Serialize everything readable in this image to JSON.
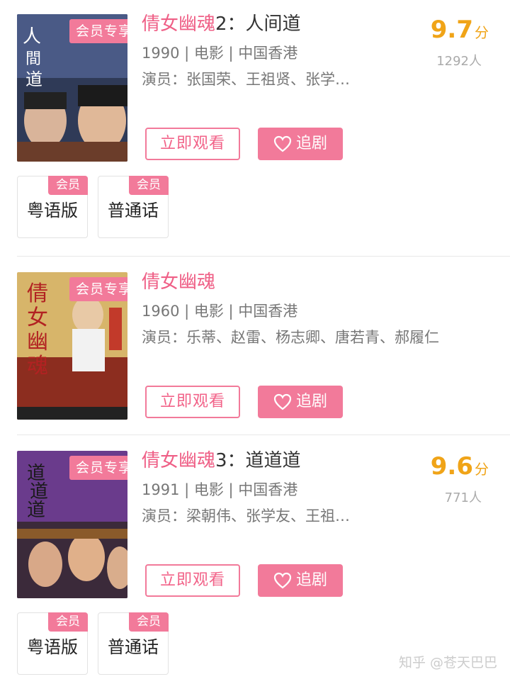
{
  "items": [
    {
      "title_pink": "倩女幽魂",
      "title_rest": "2：人间道",
      "meta": "1990 | 电影 | 中国香港",
      "actors": "演员：张国荣、王祖贤、张学…",
      "vip_tag": "会员专享",
      "score": "9.7",
      "score_unit": "分",
      "count": "1292人",
      "watch_label": "立即观看",
      "follow_label": "追剧",
      "langs": [
        {
          "label": "粤语版",
          "badge": "会员"
        },
        {
          "label": "普通话",
          "badge": "会员"
        }
      ]
    },
    {
      "title_pink": "倩女幽魂",
      "title_rest": "",
      "meta": "1960 | 电影 | 中国香港",
      "actors": "演员：乐蒂、赵雷、杨志卿、唐若青、郝履仁",
      "vip_tag": "会员专享",
      "watch_label": "立即观看",
      "follow_label": "追剧"
    },
    {
      "title_pink": "倩女幽魂",
      "title_rest": "3：道道道",
      "meta": "1991 | 电影 | 中国香港",
      "actors": "演员：梁朝伟、张学友、王祖…",
      "vip_tag": "会员专享",
      "score": "9.6",
      "score_unit": "分",
      "count": "771人",
      "watch_label": "立即观看",
      "follow_label": "追剧",
      "langs": [
        {
          "label": "粤语版",
          "badge": "会员"
        },
        {
          "label": "普通话",
          "badge": "会员"
        }
      ]
    }
  ],
  "watermark": "知乎 @苍天巴巴",
  "colors": {
    "accent": "#f27a9a",
    "accent_text": "#ef5f86",
    "score": "#f0a418"
  },
  "icons": {
    "follow": "heart-icon"
  }
}
